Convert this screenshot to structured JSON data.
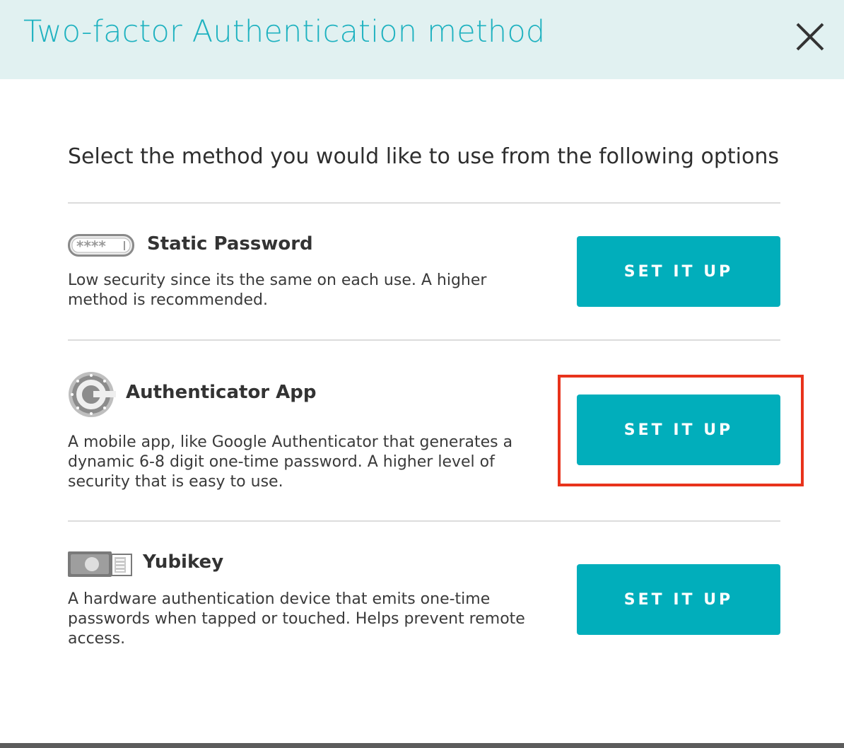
{
  "header": {
    "title": "Two-factor Authentication method"
  },
  "intro": "Select the method you would like to use from the following options",
  "methods": [
    {
      "icon": "password-field-icon",
      "title": "Static Password",
      "description": "Low security since its the same on each use. A higher method is recommended.",
      "button_label": "SET IT UP"
    },
    {
      "icon": "authenticator-app-icon",
      "title": "Authenticator App",
      "description": "A mobile app, like Google Authenticator that generates a dynamic 6-8 digit one-time password. A higher level of security that is easy to use.",
      "button_label": "SET IT UP",
      "highlighted": true
    },
    {
      "icon": "yubikey-icon",
      "title": "Yubikey",
      "description": "A hardware authentication device that emits one-time passwords when tapped or touched. Helps prevent remote access.",
      "button_label": "SET IT UP"
    }
  ],
  "colors": {
    "header_bg": "#e1f1f1",
    "title": "#1fb2c0",
    "button": "#01aebb",
    "highlight_box": "#e8331c"
  }
}
